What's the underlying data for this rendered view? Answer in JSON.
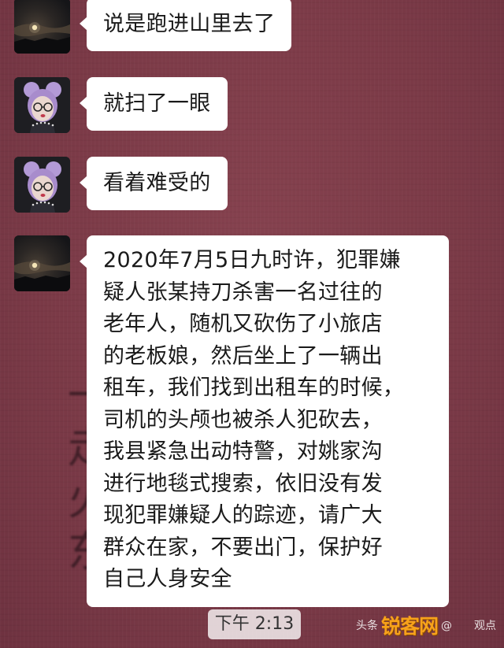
{
  "messages": [
    {
      "sender": "moon-avatar",
      "text": "说是跑进山里去了"
    },
    {
      "sender": "girl-avatar",
      "text": "就扫了一眼"
    },
    {
      "sender": "girl-avatar",
      "text": "看着难受的"
    },
    {
      "sender": "moon-avatar",
      "lines": [
        "2020年7月5日九时许，犯罪嫌",
        "疑人张某持刀杀害一名过往的",
        "老年人，随机又砍伤了小旅店",
        "的老板娘，然后坐上了一辆出",
        "租车，我们找到出租车的时候，",
        "司机的头颅也被杀人犯砍去，",
        "我县紧急出动特警，对姚家沟",
        "进行地毯式搜索，依旧没有发",
        "现犯罪嫌疑人的踪迹，请广大",
        "群众在家，不要出门，保护好",
        "自己人身安全"
      ]
    }
  ],
  "timestamp": "下午 2:13",
  "background_text": [
    "一",
    "走",
    "火",
    "东"
  ],
  "watermark": {
    "source": "头条",
    "logo": "锐客网",
    "author": "@　　观点"
  },
  "colors": {
    "background": "#7b3a47",
    "bubble": "#ffffff",
    "text": "#1a1a1a",
    "logo": "#f7a21b"
  }
}
